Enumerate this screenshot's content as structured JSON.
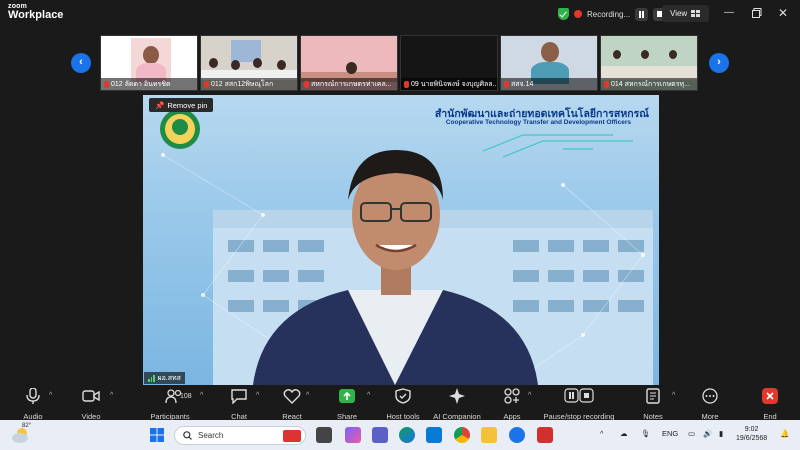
{
  "app": {
    "logo_line1": "zoom",
    "logo_line2": "Workplace"
  },
  "titlebar": {
    "recording_label": "Recording...",
    "view_label": "View"
  },
  "participants_strip": [
    {
      "name": "012 ลัดดา อินทรชิต"
    },
    {
      "name": "012 สสก12พิษณุโลก"
    },
    {
      "name": "สหกรณ์การเกษตรท่าเคล..."
    },
    {
      "name": "09 นายพินิจพงษ์ จงบุญศิลล..."
    },
    {
      "name": "สสจ.14"
    },
    {
      "name": "014 สหกรณ์การเกษตรทุ..."
    }
  ],
  "main_video": {
    "remove_pin_label": "Remove pin",
    "speaker_name": "ผอ.สทส",
    "banner_thai": "สำนักพัฒนาและถ่ายทอดเทคโนโลยีการสหกรณ์",
    "banner_english": "Cooperative Technology Transfer and Development Officers"
  },
  "toolbar": {
    "audio": "Audio",
    "video": "Video",
    "participants": "Participants",
    "participants_count": "108",
    "chat": "Chat",
    "react": "React",
    "share": "Share",
    "host_tools": "Host tools",
    "ai_companion": "AI Companion",
    "apps": "Apps",
    "pause_stop": "Pause/stop recording",
    "notes": "Notes",
    "more": "More",
    "end": "End"
  },
  "taskbar": {
    "temperature": "82°",
    "search_placeholder": "Search",
    "language": "ENG",
    "time": "9:02",
    "date": "19/6/2568"
  },
  "colors": {
    "accent_blue": "#1a73e8",
    "recording_red": "#e0392b",
    "share_green": "#2fb34a",
    "end_red": "#e0392b"
  }
}
